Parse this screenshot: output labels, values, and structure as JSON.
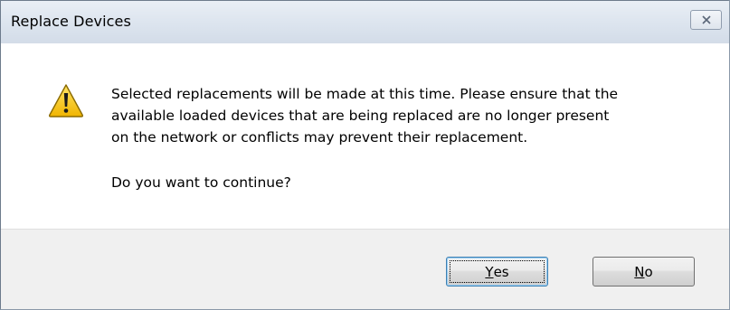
{
  "window": {
    "title": "Replace Devices",
    "close_icon": "close-icon"
  },
  "message": {
    "icon": "warning-icon",
    "lines": [
      "Selected replacements will be made at this time.  Please ensure that the",
      "available loaded devices that are being replaced are no longer present",
      "on the network or conflicts may prevent their replacement."
    ],
    "question": "Do you want to continue?"
  },
  "buttons": {
    "yes": {
      "mnemonic": "Y",
      "rest": "es",
      "default": true
    },
    "no": {
      "mnemonic": "N",
      "rest": "o",
      "default": false
    }
  },
  "colors": {
    "warning_yellow": "#f5c400",
    "warning_border": "#8a6a00",
    "footer_background": "#f0f0f0"
  }
}
